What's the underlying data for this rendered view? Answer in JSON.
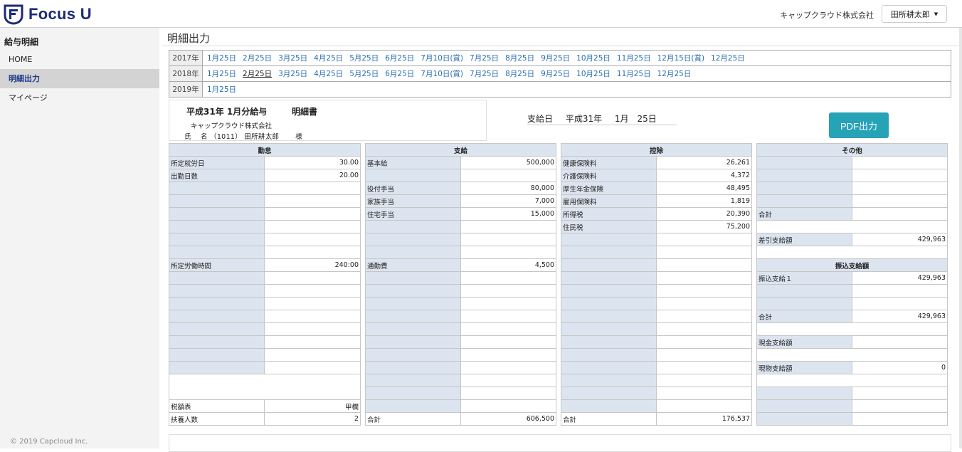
{
  "header": {
    "logo_text": "Focus U",
    "company": "キャップクラウド株式会社",
    "user": "田所耕太郎"
  },
  "sidebar": {
    "title": "給与明細",
    "items": [
      {
        "label": "HOME"
      },
      {
        "label": "明細出力"
      },
      {
        "label": "マイページ"
      }
    ],
    "copyright": "© 2019 Capcloud Inc."
  },
  "page": {
    "title": "明細出力"
  },
  "years": [
    {
      "year": "2017年",
      "dates": [
        "1月25日",
        "2月25日",
        "3月25日",
        "4月25日",
        "5月25日",
        "6月25日",
        "7月10日(賞)",
        "7月25日",
        "8月25日",
        "9月25日",
        "10月25日",
        "11月25日",
        "12月15日(賞)",
        "12月25日"
      ]
    },
    {
      "year": "2018年",
      "dates": [
        "1月25日",
        "2月25日",
        "3月25日",
        "4月25日",
        "5月25日",
        "6月25日",
        "7月10日(賞)",
        "7月25日",
        "8月25日",
        "9月25日",
        "10月25日",
        "11月25日",
        "12月25日"
      ]
    },
    {
      "year": "2019年",
      "dates": [
        "1月25日"
      ]
    }
  ],
  "slip": {
    "title": "平成31年 1月分給与",
    "doc": "明細書",
    "company": "キャップクラウド株式会社",
    "name_line": "氏　 名 （1011） 田所耕太郎　　 様",
    "pay_date": "支給日　 平成31年　 1月　25日",
    "pdf_button": "PDF出力"
  },
  "attendance": {
    "header": "勤怠",
    "rows": [
      {
        "label": "所定就労日",
        "value": "30.00"
      },
      {
        "label": "出勤日数",
        "value": "20.00"
      },
      {
        "label": "",
        "value": ""
      },
      {
        "label": "",
        "value": ""
      },
      {
        "label": "",
        "value": ""
      },
      {
        "label": "",
        "value": ""
      },
      {
        "label": "",
        "value": ""
      },
      {
        "label": "",
        "value": ""
      },
      {
        "label": "所定労働時間",
        "value": "240:00"
      },
      {
        "label": "",
        "value": ""
      },
      {
        "label": "",
        "value": ""
      },
      {
        "label": "",
        "value": ""
      },
      {
        "label": "",
        "value": ""
      },
      {
        "label": "",
        "value": ""
      },
      {
        "label": "",
        "value": ""
      },
      {
        "label": "",
        "value": ""
      },
      {
        "label": "",
        "value": ""
      }
    ],
    "tax_table_label": "税額表",
    "tax_table_value": "甲欄",
    "dependents_label": "扶養人数",
    "dependents_value": "2"
  },
  "payment": {
    "header": "支給",
    "rows": [
      {
        "label": "基本給",
        "value": "500,000"
      },
      {
        "label": "",
        "value": ""
      },
      {
        "label": "役付手当",
        "value": "80,000"
      },
      {
        "label": "家族手当",
        "value": "7,000"
      },
      {
        "label": "住宅手当",
        "value": "15,000"
      },
      {
        "label": "",
        "value": ""
      },
      {
        "label": "",
        "value": ""
      },
      {
        "label": "",
        "value": ""
      },
      {
        "label": "通勤費",
        "value": "4,500"
      },
      {
        "label": "",
        "value": ""
      },
      {
        "label": "",
        "value": ""
      },
      {
        "label": "",
        "value": ""
      },
      {
        "label": "",
        "value": ""
      },
      {
        "label": "",
        "value": ""
      },
      {
        "label": "",
        "value": ""
      },
      {
        "label": "",
        "value": ""
      },
      {
        "label": "",
        "value": ""
      },
      {
        "label": "",
        "value": ""
      },
      {
        "label": "",
        "value": ""
      },
      {
        "label": "",
        "value": ""
      }
    ],
    "total_label": "合計",
    "total_value": "606,500"
  },
  "deduction": {
    "header": "控除",
    "rows": [
      {
        "label": "健康保険料",
        "value": "26,261"
      },
      {
        "label": "介護保険料",
        "value": "4,372"
      },
      {
        "label": "厚生年金保険",
        "value": "48,495"
      },
      {
        "label": "雇用保険料",
        "value": "1,819"
      },
      {
        "label": "所得税",
        "value": "20,390"
      },
      {
        "label": "住民税",
        "value": "75,200"
      },
      {
        "label": "",
        "value": ""
      },
      {
        "label": "",
        "value": ""
      },
      {
        "label": "",
        "value": ""
      },
      {
        "label": "",
        "value": ""
      },
      {
        "label": "",
        "value": ""
      },
      {
        "label": "",
        "value": ""
      },
      {
        "label": "",
        "value": ""
      },
      {
        "label": "",
        "value": ""
      },
      {
        "label": "",
        "value": ""
      },
      {
        "label": "",
        "value": ""
      },
      {
        "label": "",
        "value": ""
      },
      {
        "label": "",
        "value": ""
      },
      {
        "label": "",
        "value": ""
      },
      {
        "label": "",
        "value": ""
      }
    ],
    "total_label": "合計",
    "total_value": "176,537"
  },
  "other": {
    "header": "その他",
    "rows_top": [
      {
        "label": "",
        "value": ""
      },
      {
        "label": "",
        "value": ""
      },
      {
        "label": "",
        "value": ""
      },
      {
        "label": "",
        "value": ""
      }
    ],
    "subtotal_label": "合計",
    "net_label": "差引支給額",
    "net_value": "429,963",
    "transfer_header": "振込支給額",
    "transfer1_label": "振込支給１",
    "transfer1_value": "429,963",
    "transfer_total_label": "合計",
    "transfer_total_value": "429,963",
    "cash_label": "現金支給額",
    "kind_label": "現物支給額",
    "kind_value": "0"
  }
}
